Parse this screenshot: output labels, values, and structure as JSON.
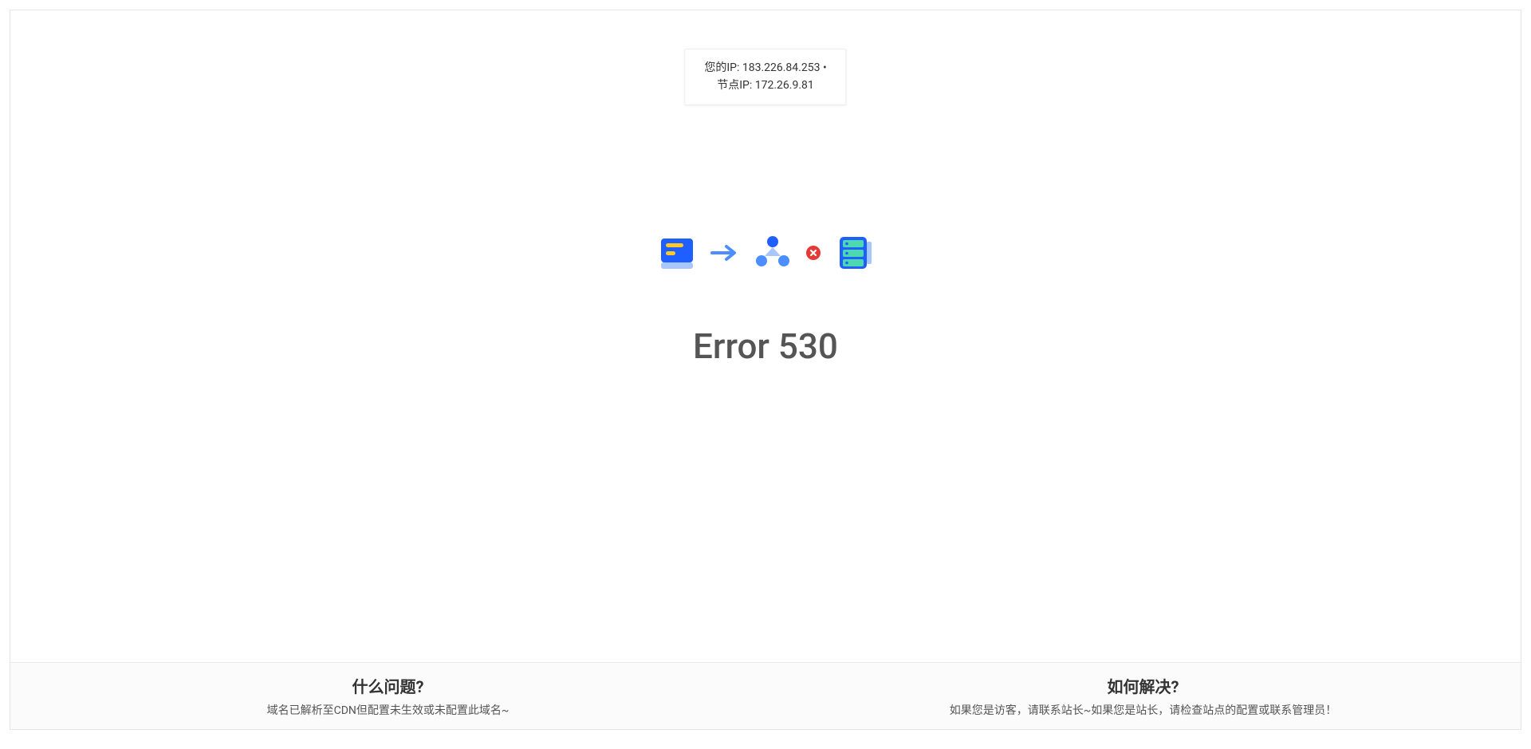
{
  "ip_info": {
    "your_ip_label": "您的IP:",
    "your_ip_value": "183.226.84.253",
    "separator": "•",
    "node_ip_label": "节点IP:",
    "node_ip_value": "172.26.9.81"
  },
  "error": {
    "title": "Error 530"
  },
  "footer": {
    "problem": {
      "title": "什么问题?",
      "desc": "域名已解析至CDN但配置未生效或未配置此域名~"
    },
    "solution": {
      "title": "如何解决?",
      "desc": "如果您是访客，请联系站长~如果您是站长，请检查站点的配置或联系管理员！"
    }
  }
}
